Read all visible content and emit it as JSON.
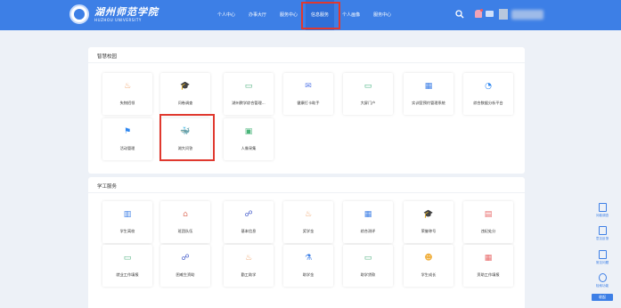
{
  "header": {
    "logo_cn": "湖州师范学院",
    "logo_en": "HUZHOU UNIVERSITY",
    "nav": [
      "个人中心",
      "办事大厅",
      "服务中心",
      "信息服务",
      "个人画像",
      "服务中心"
    ]
  },
  "sections": [
    {
      "title": "智慧校园",
      "tiles": [
        {
          "label": "失物招领",
          "icon": "people-heart-icon",
          "color": "#f0a36b"
        },
        {
          "label": "问卷调查",
          "icon": "graduation-cap-icon",
          "color": "#d77fd6"
        },
        {
          "label": "湖州教学综合管理...",
          "icon": "monitor-icon",
          "color": "#4caf7d"
        },
        {
          "label": "健康打卡助手",
          "icon": "chat-icon",
          "color": "#5b7de8"
        },
        {
          "label": "大屏门户",
          "icon": "screen-icon",
          "color": "#3fb07c"
        },
        {
          "label": "实训室预约管理系统",
          "icon": "calendar-icon",
          "color": "#3d7fe6"
        },
        {
          "label": "综合数据分析平台",
          "icon": "chart-icon",
          "color": "#2d86f0"
        },
        {
          "label": "活动管理",
          "icon": "flag-icon",
          "color": "#2d86f0"
        },
        {
          "label": "湖大问答",
          "icon": "whale-icon",
          "color": "#3b66c9"
        },
        {
          "label": "人像采集",
          "icon": "camera-icon",
          "color": "#4ab57a"
        }
      ]
    },
    {
      "title": "学工服务",
      "tiles": [
        {
          "label": "学生离校",
          "icon": "building-icon",
          "color": "#3d7fe6"
        },
        {
          "label": "班团队伍",
          "icon": "bank-icon",
          "color": "#e07a6a"
        },
        {
          "label": "基本信息",
          "icon": "users-icon",
          "color": "#4058c9"
        },
        {
          "label": "奖学金",
          "icon": "people-heart-icon",
          "color": "#f0a36b"
        },
        {
          "label": "综合测评",
          "icon": "table-icon",
          "color": "#3d7fe6"
        },
        {
          "label": "荣誉称号",
          "icon": "graduation-cap-icon",
          "color": "#d77fd6"
        },
        {
          "label": "违纪处分",
          "icon": "document-icon",
          "color": "#e86a6a"
        },
        {
          "label": "就业工作填报",
          "icon": "screen-icon",
          "color": "#4caf7d"
        },
        {
          "label": "困难生资助",
          "icon": "users-icon",
          "color": "#4058c9"
        },
        {
          "label": "勤工助学",
          "icon": "people-heart-icon",
          "color": "#f0a36b"
        },
        {
          "label": "助学金",
          "icon": "flask-icon",
          "color": "#3d7fe6"
        },
        {
          "label": "助学贷款",
          "icon": "screen-icon",
          "color": "#4caf7d"
        },
        {
          "label": "学生成长",
          "icon": "teacher-icon",
          "color": "#f0b040"
        },
        {
          "label": "资助工作填报",
          "icon": "calendar-icon",
          "color": "#e86a6a"
        }
      ]
    }
  ],
  "sidebar": [
    {
      "label": "问卷调查",
      "icon": "survey-icon"
    },
    {
      "label": "意见反馈",
      "icon": "message-icon"
    },
    {
      "label": "常见问题",
      "icon": "faq-icon"
    },
    {
      "label": "检索功能",
      "icon": "search-icon"
    }
  ],
  "sidebar_footer": "收起"
}
